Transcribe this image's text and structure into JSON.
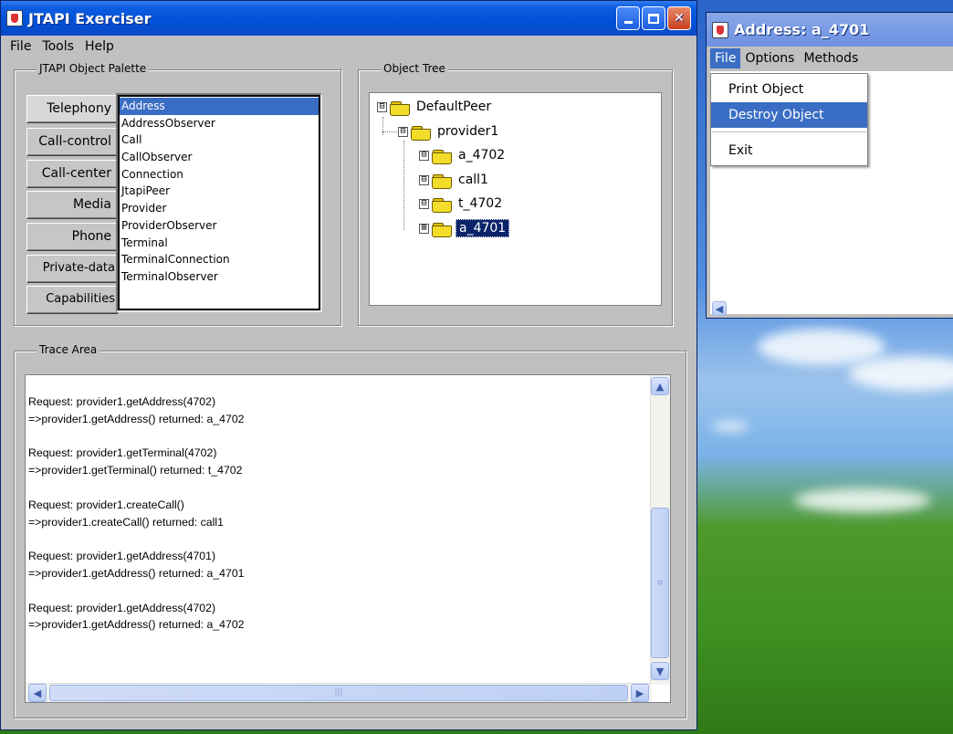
{
  "main_window": {
    "title": "JTAPI Exerciser",
    "menu": [
      "File",
      "Tools",
      "Help"
    ],
    "palette": {
      "title": "JTAPI Object Palette",
      "buttons": [
        "Telephony",
        "Call-control",
        "Call-center",
        "Media",
        "Phone",
        "Private-data",
        "Capabilities"
      ],
      "list_items": [
        "Address",
        "AddressObserver",
        "Call",
        "CallObserver",
        "Connection",
        "JtapiPeer",
        "Provider",
        "ProviderObserver",
        "Terminal",
        "TerminalConnection",
        "TerminalObserver"
      ],
      "selected_item": "Address"
    },
    "object_tree": {
      "title": "Object Tree",
      "nodes": [
        {
          "label": "DefaultPeer",
          "expander": "⊟",
          "selected": false
        },
        {
          "label": "provider1",
          "expander": "⊟",
          "selected": false
        },
        {
          "label": "a_4702",
          "expander": "⊟",
          "selected": false
        },
        {
          "label": "call1",
          "expander": "⊟",
          "selected": false
        },
        {
          "label": "t_4702",
          "expander": "⊟",
          "selected": false
        },
        {
          "label": "a_4701",
          "expander": "⊞",
          "selected": true
        }
      ]
    },
    "trace_area": {
      "title": "Trace Area",
      "lines": [
        "Request: provider1.getAddress(4702)",
        "=>provider1.getAddress() returned: a_4702",
        "",
        "Request: provider1.getTerminal(4702)",
        "=>provider1.getTerminal() returned: t_4702",
        "",
        "Request: provider1.createCall()",
        "=>provider1.createCall() returned: call1",
        "",
        "Request: provider1.getAddress(4701)",
        "=>provider1.getAddress() returned: a_4701",
        "",
        "Request: provider1.getAddress(4702)",
        "=>provider1.getAddress() returned: a_4702"
      ]
    }
  },
  "address_window": {
    "title": "Address: a_4701",
    "menu": [
      "File",
      "Options",
      "Methods"
    ],
    "active_menu": "File",
    "file_menu_items": [
      "Print Object",
      "Destroy Object",
      "Exit"
    ],
    "highlighted_item": "Destroy Object"
  }
}
